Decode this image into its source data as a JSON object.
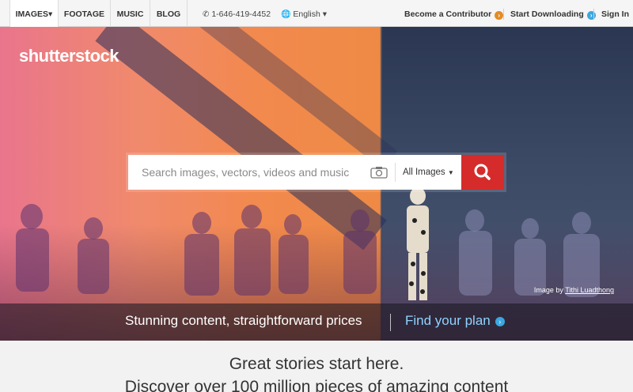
{
  "nav": {
    "tabs": [
      {
        "label": "IMAGES▾"
      },
      {
        "label": "FOOTAGE"
      },
      {
        "label": "MUSIC"
      },
      {
        "label": "BLOG"
      }
    ],
    "phone": "1-646-419-4452",
    "language": "English ▾",
    "contributor": "Become a Contributor",
    "start": "Start Downloading",
    "signin": "Sign In"
  },
  "hero": {
    "logo": "shutterstock",
    "search_placeholder": "Search images, vectors, videos and music",
    "search_type": "All Images",
    "credit_prefix": "Image by",
    "credit_author": "Tithi Luadthong",
    "tagline_left": "Stunning content, straightforward prices",
    "tagline_right": "Find your plan"
  },
  "main": {
    "headline1": "Great stories start here.",
    "headline2": "Discover over 100 million pieces of amazing content"
  },
  "colors": {
    "accent_red": "#d62b2b",
    "contributor_orange": "#e38b25",
    "start_blue": "#3ba7e0",
    "plan_blue": "#8fd3ff"
  }
}
